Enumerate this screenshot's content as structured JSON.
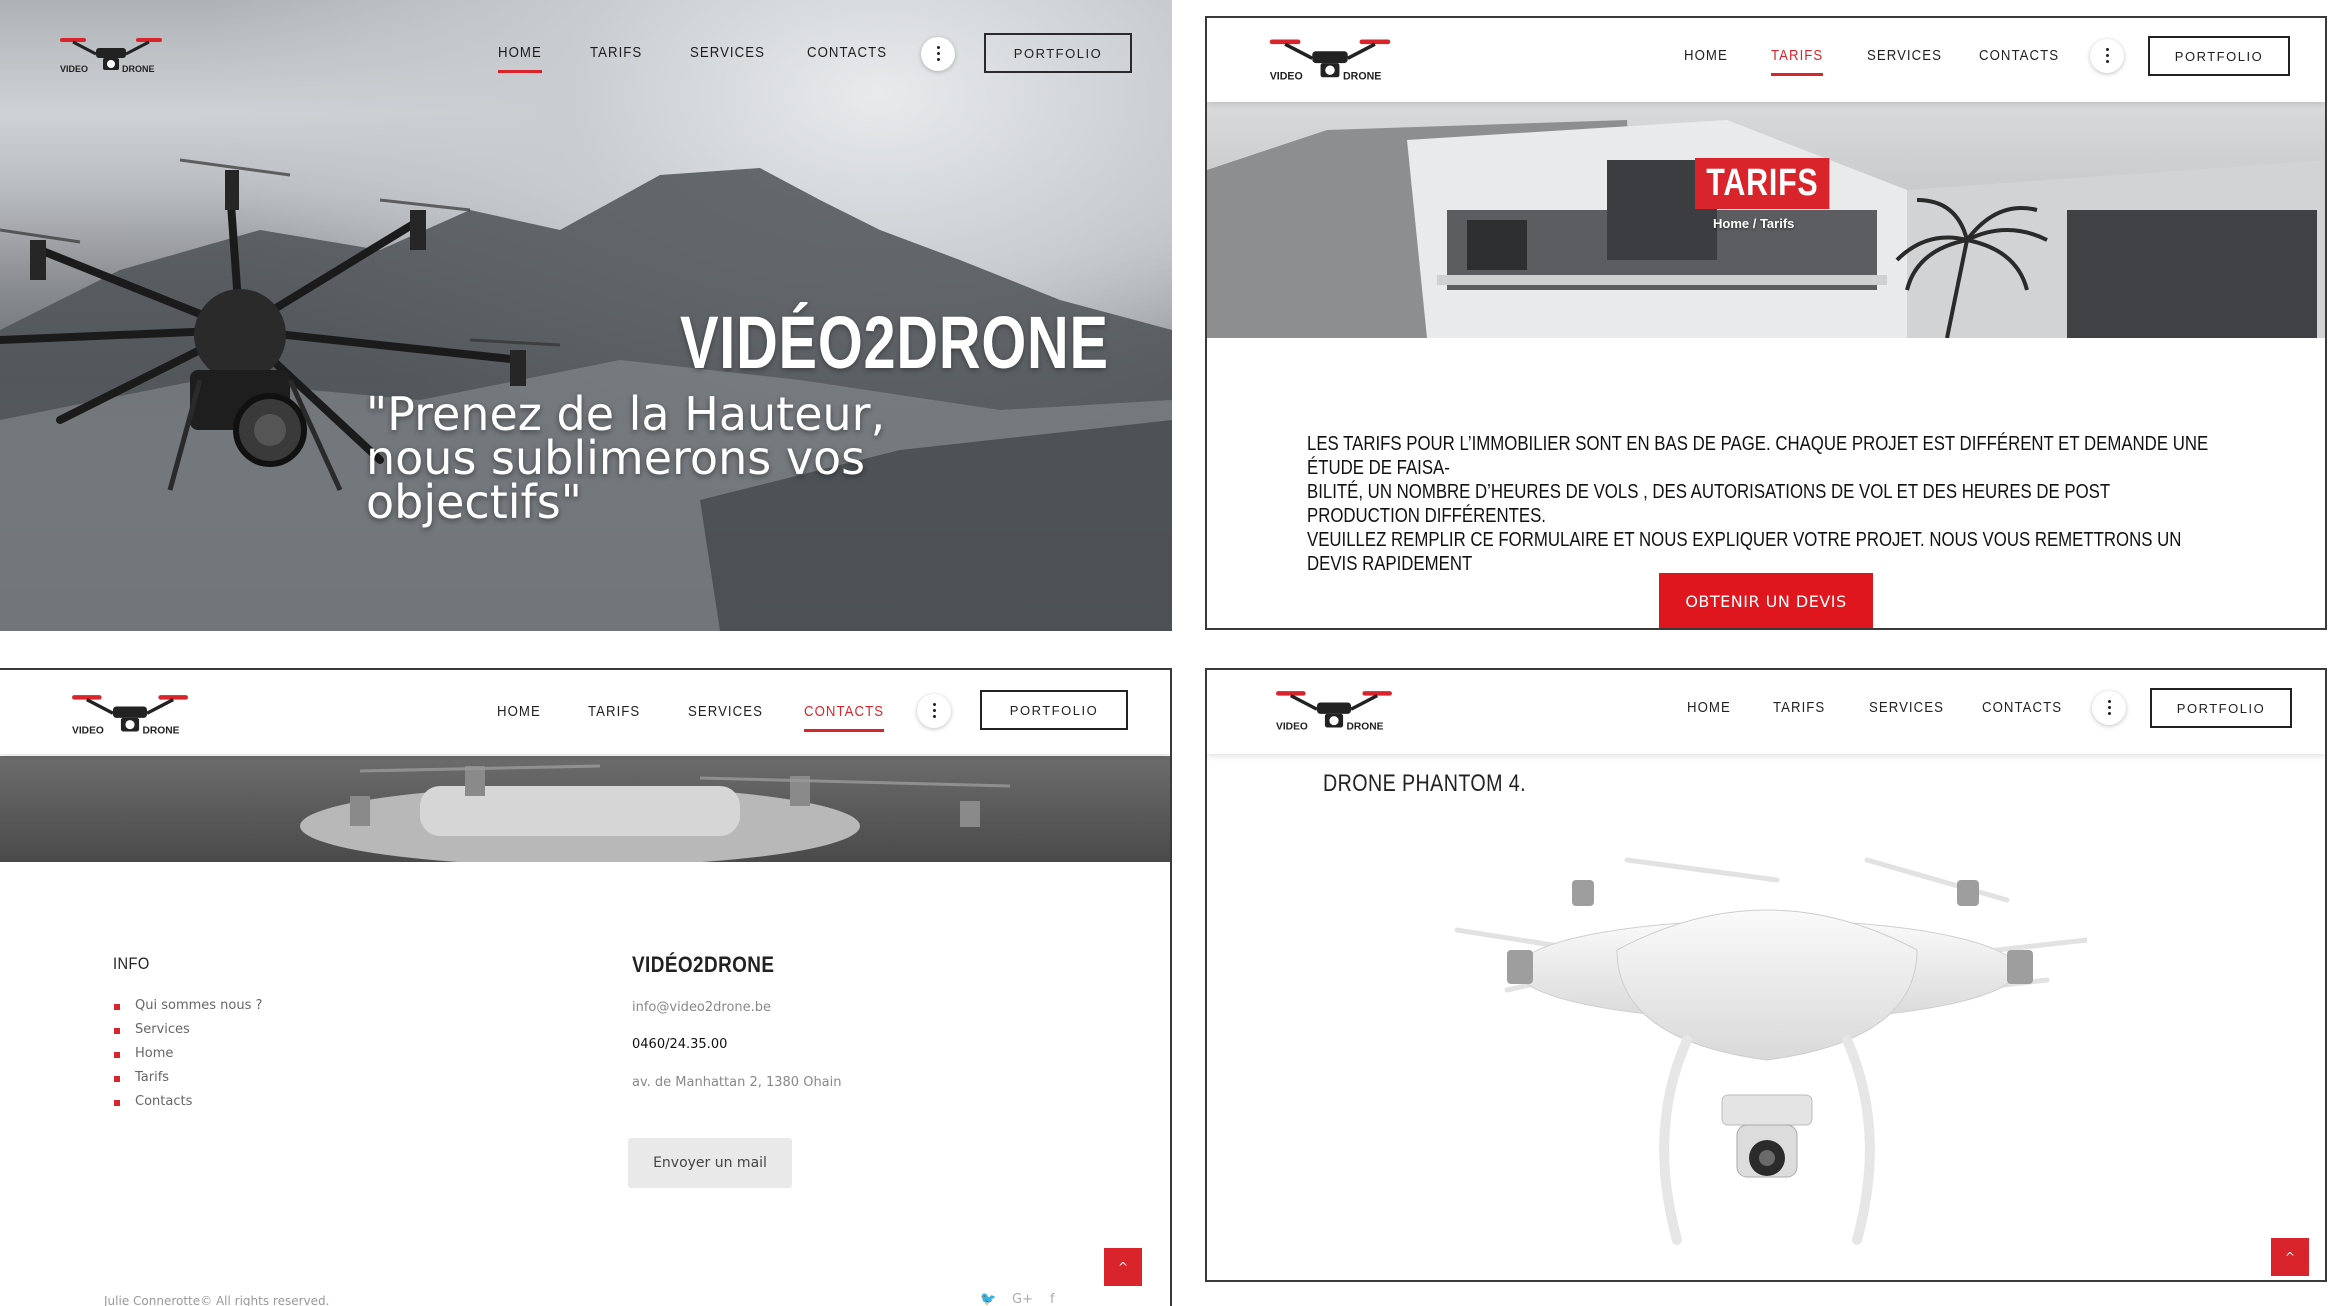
{
  "brand": {
    "logo_text_left": "VIDEO",
    "logo_text_right": "DRONE",
    "accent_color": "#d8242a",
    "dark_color": "#222222"
  },
  "nav": {
    "items": [
      "HOME",
      "TARIFS",
      "SERVICES",
      "CONTACTS"
    ],
    "portfolio_label": "PORTFOLIO",
    "more_icon": "vertical-dots-icon"
  },
  "panel_home": {
    "active": "HOME",
    "title": "VIDÉO2DRONE",
    "subtitle_line1": "\"Prenez de la Hauteur,",
    "subtitle_line2": "nous sublimerons vos objectifs\""
  },
  "panel_tarifs": {
    "active": "TARIFS",
    "banner_title": "TARIFS",
    "breadcrumb": "Home / Tarifs",
    "text_line1": "LES TARIFS POUR L’IMMOBILIER SONT EN BAS DE PAGE. CHAQUE PROJET EST DIFFÉRENT ET DEMANDE UNE ÉTUDE DE FAISA-",
    "text_line2": "BILITÉ, UN NOMBRE D’HEURES DE VOLS , DES AUTORISATIONS DE VOL ET DES HEURES DE POST PRODUCTION DIFFÉRENTES.",
    "text_line3": "VEUILLEZ REMPLIR CE FORMULAIRE ET NOUS EXPLIQUER VOTRE PROJET. NOUS VOUS REMETTRONS UN DEVIS RAPIDEMENT",
    "cta_label": "OBTENIR UN DEVIS"
  },
  "panel_contacts": {
    "active": "CONTACTS",
    "info_heading": "INFO",
    "info_links": [
      "Qui sommes nous ?",
      "Services",
      "Home",
      "Tarifs",
      "Contacts"
    ],
    "company_heading": "VIDÉO2DRONE",
    "email": "info@video2drone.be",
    "phone": "0460/24.35.00",
    "address": "av. de Manhattan 2, 1380 Ohain",
    "mail_button": "Envoyer un mail",
    "copyright": "Julie Connerotte© All rights reserved.",
    "social_icons": [
      "twitter-icon",
      "google-plus-icon",
      "facebook-icon"
    ],
    "social_glyphs": [
      "🐦",
      "G+",
      "f"
    ],
    "back_to_top_glyph": "^"
  },
  "panel_phantom": {
    "title": "DRONE PHANTOM 4.",
    "back_to_top_glyph": "^"
  }
}
